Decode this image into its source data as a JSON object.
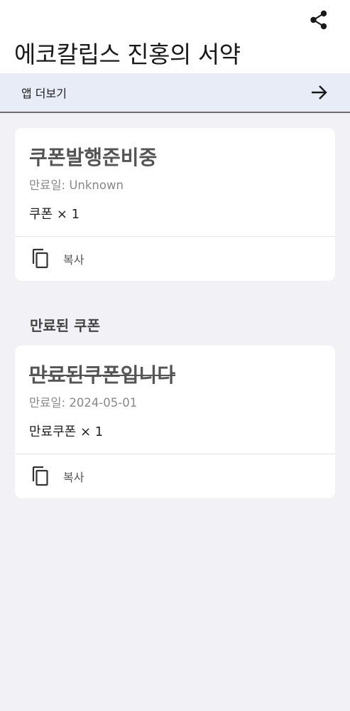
{
  "header": {
    "title": "에코칼립스 진홍의 서약",
    "share_icon": "share-icon"
  },
  "more_apps": {
    "label": "앱 더보기",
    "icon": "arrow-right-icon"
  },
  "active_coupons": [
    {
      "title": "쿠폰발행준비중",
      "expiry": "만료일: Unknown",
      "quantity": "쿠폰 × 1",
      "copy_label": "복사",
      "copy_icon": "copy-icon"
    }
  ],
  "expired_section": {
    "title": "만료된 쿠폰"
  },
  "expired_coupons": [
    {
      "title": "만료된쿠폰입니다",
      "expiry": "만료일: 2024-05-01",
      "quantity": "만료쿠폰 × 1",
      "copy_label": "복사",
      "copy_icon": "copy-icon"
    }
  ],
  "colors": {
    "background": "#f2f2f6",
    "header_background": "#ffffff",
    "banner_background": "#e8ecf6",
    "title_text": "#555555",
    "muted_text": "#888888"
  }
}
